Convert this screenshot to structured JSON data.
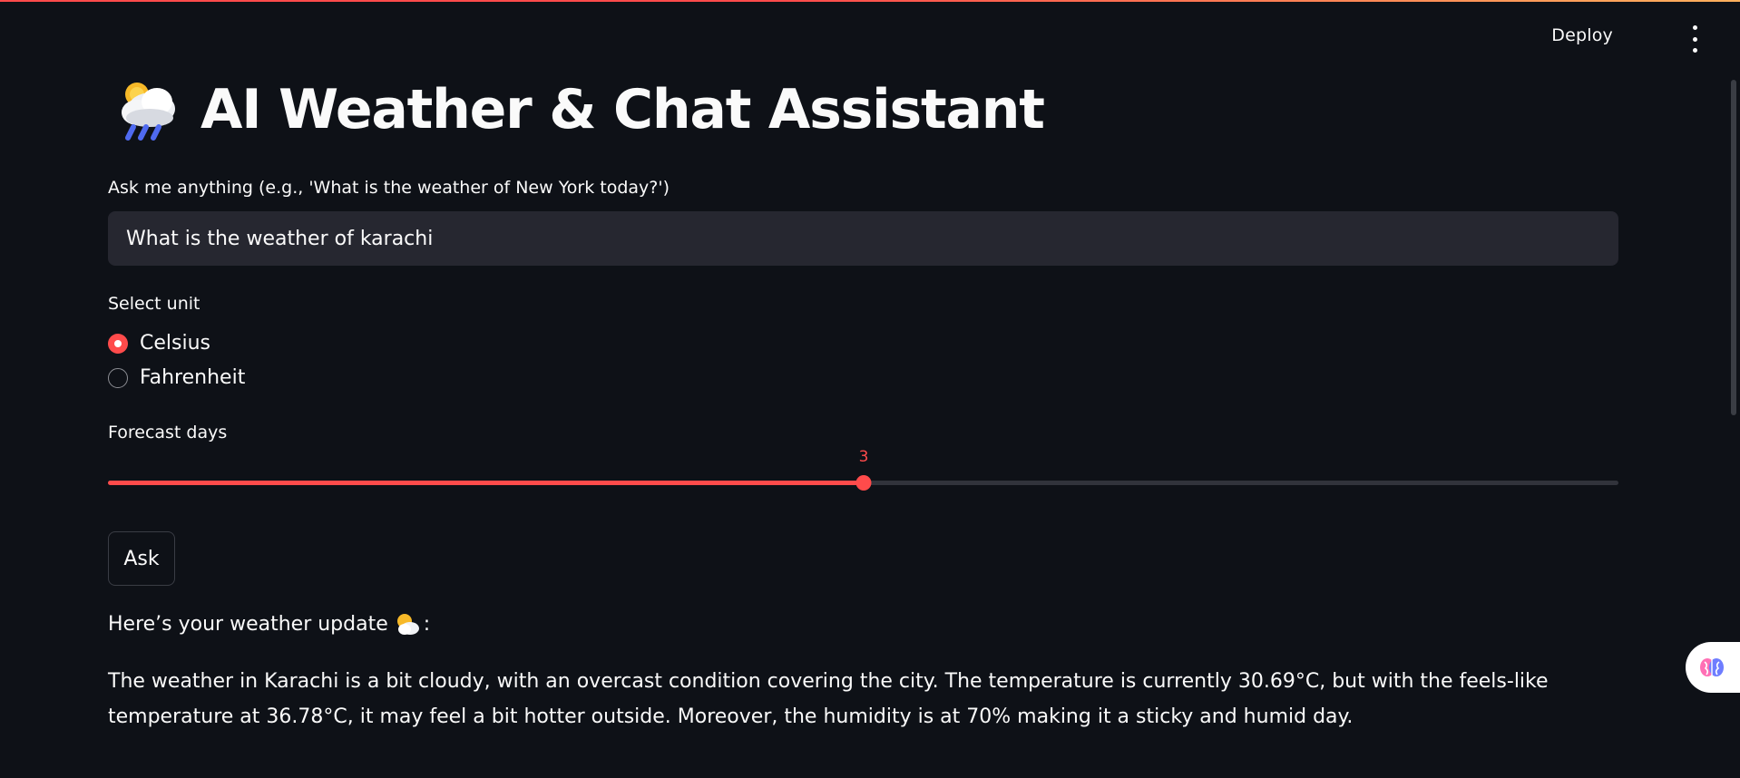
{
  "header": {
    "deploy_label": "Deploy",
    "menu_icon": "kebab-menu-icon"
  },
  "title": {
    "icon": "cloud-rain-sun-icon",
    "text": "AI Weather & Chat Assistant"
  },
  "query": {
    "label": "Ask me anything (e.g., 'What is the weather of New York today?')",
    "value": "What is the weather of karachi"
  },
  "unit": {
    "label": "Select unit",
    "options": [
      "Celsius",
      "Fahrenheit"
    ],
    "selected": "Celsius"
  },
  "forecast": {
    "label": "Forecast days",
    "value": "3",
    "fraction": 0.5
  },
  "ask_button": {
    "label": "Ask"
  },
  "result": {
    "heading_before": "Here’s your weather update",
    "heading_icon": "sun-behind-cloud-icon",
    "heading_after": ":",
    "body": "The weather in Karachi is a bit cloudy, with an overcast condition covering the city. The temperature is currently 30.69°C, but with the feels-like temperature at 36.78°C, it may feel a bit hotter outside. Moreover, the humidity is at 70% making it a sticky and humid day."
  },
  "colors": {
    "background": "#0e1117",
    "accent": "#ff4b4b",
    "input_bg": "#262730",
    "text": "#fafafa"
  }
}
